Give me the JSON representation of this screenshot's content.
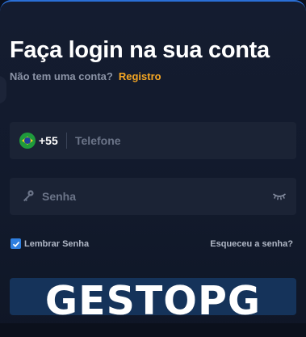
{
  "login": {
    "title": "Faça login na sua conta",
    "no_account_text": "Não tem uma conta?",
    "register_link": "Registro"
  },
  "phone": {
    "country_code": "+55",
    "placeholder": "Telefone",
    "flag_icon": "brazil-flag-icon"
  },
  "password": {
    "placeholder": "Senha",
    "key_icon": "key-icon",
    "toggle_icon": "eye-closed-icon"
  },
  "options": {
    "remember_label": "Lembrar Senha",
    "remember_checked": true,
    "forgot_link": "Esqueceu a senha?"
  },
  "watermark": {
    "text": "GESTOPG"
  },
  "colors": {
    "accent": "#f5a623",
    "checkbox": "#2f7fe0",
    "field_bg": "#1b2335",
    "button_bg": "#15335a"
  }
}
